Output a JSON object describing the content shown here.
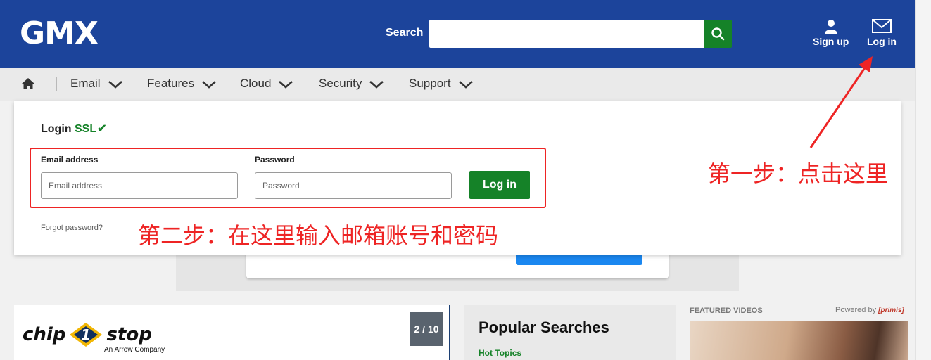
{
  "header": {
    "logo": "GMX",
    "search_label": "Search",
    "search_placeholder": "",
    "actions": {
      "signup": "Sign up",
      "login": "Log in"
    }
  },
  "nav": {
    "items": [
      {
        "label": "Email"
      },
      {
        "label": "Features"
      },
      {
        "label": "Cloud"
      },
      {
        "label": "Security"
      },
      {
        "label": "Support"
      }
    ]
  },
  "login_panel": {
    "title": "Login",
    "ssl": "SSL",
    "email_label": "Email address",
    "email_placeholder": "Email address",
    "password_label": "Password",
    "password_placeholder": "Password",
    "submit": "Log in",
    "forgot": "Forgot password?"
  },
  "annotations": {
    "step1": "第一步：点击这里",
    "step2": "第二步：在这里输入邮箱账号和密码",
    "color": "#ee2424"
  },
  "ad": {
    "brand_left": "chip",
    "brand_mark": "1",
    "brand_right": "stop",
    "tagline": "An Arrow Company",
    "counter": "2 / 10"
  },
  "popular": {
    "title": "Popular Searches",
    "hot_topics": "Hot Topics"
  },
  "featured": {
    "label": "FEATURED VIDEOS",
    "powered_by": "Powered by",
    "powered_brand": "[primis]"
  },
  "colors": {
    "header_blue": "#1c449b",
    "brand_green": "#158228"
  }
}
